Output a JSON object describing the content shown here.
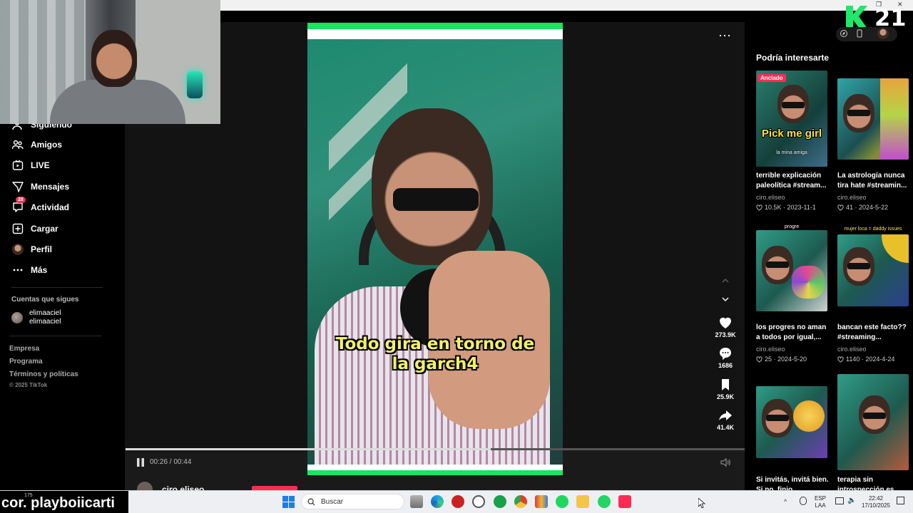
{
  "sidebar": {
    "items": [
      {
        "label": "Siguiendo",
        "icon": "following-icon"
      },
      {
        "label": "Amigos",
        "icon": "friends-icon"
      },
      {
        "label": "LIVE",
        "icon": "live-icon"
      },
      {
        "label": "Mensajes",
        "icon": "messages-icon"
      },
      {
        "label": "Actividad",
        "icon": "activity-icon",
        "badge": "28"
      },
      {
        "label": "Cargar",
        "icon": "upload-icon"
      },
      {
        "label": "Perfil",
        "icon": "profile-avatar"
      },
      {
        "label": "Más",
        "icon": "more-icon"
      }
    ],
    "following_heading": "Cuentas que sigues",
    "following": [
      {
        "display_name": "elimaaciel",
        "username": "elimaaciel"
      }
    ],
    "footer_links": [
      "Empresa",
      "Programa",
      "Términos y políticas"
    ],
    "copyright": "© 2025 TikTok"
  },
  "video": {
    "caption_line1": "Todo gira en torno de",
    "caption_line2": "la garch4",
    "time_current": "00:26",
    "time_total": "00:44",
    "timecode": "00:26 / 00:44",
    "progress": 0.59,
    "author": "ciro.eliseo",
    "actions": [
      {
        "name": "like",
        "icon": "heart-icon",
        "count": "273.9K"
      },
      {
        "name": "comment",
        "icon": "comment-icon",
        "count": "1686"
      },
      {
        "name": "save",
        "icon": "bookmark-icon",
        "count": "25.9K"
      },
      {
        "name": "share",
        "icon": "share-icon",
        "count": "41.4K"
      }
    ],
    "more_label": "⋯"
  },
  "recommendations": {
    "title": "Podría interesarte",
    "items": [
      {
        "title": "terrible explicación paleolítica #stream...",
        "author": "ciro.eliseo",
        "likes": "10.5K",
        "date": "2023-11-1",
        "pinned": "Anclado",
        "overlay": "Pick me girl",
        "tag": "la mina amiga"
      },
      {
        "title": "La astrología nunca tira hate #streamin...",
        "author": "ciro.eliseo",
        "likes": "41",
        "date": "2024-5-22"
      },
      {
        "title": "los progres no aman a todos por igual,...",
        "author": "ciro.eliseo",
        "likes": "25",
        "date": "2024-5-20",
        "tag": "progre"
      },
      {
        "title": "bancan este facto?? #streaming...",
        "author": "ciro.eliseo",
        "likes": "1140",
        "date": "2024-4-24",
        "tag": "mujer loca = daddy issues"
      },
      {
        "title": "Si invitás, invitá bien. Si no, finjo...",
        "author": "",
        "likes": "",
        "date": ""
      },
      {
        "title": "terapia sin introspección es...",
        "author": "",
        "likes": "",
        "date": ""
      }
    ]
  },
  "overlay": {
    "logo_number": "21",
    "ticker_count": "175",
    "ticker_text": "cor. playboiicarti"
  },
  "taskbar": {
    "search_placeholder": "Buscar",
    "language_line1": "ESP",
    "language_line2": "LAA",
    "time": "22:42",
    "date": "17/10/2025"
  },
  "colors": {
    "accent": "#fe2c55",
    "video_green": "#19e55f",
    "caption_yellow": "#f2f06a",
    "background": "#121212"
  }
}
